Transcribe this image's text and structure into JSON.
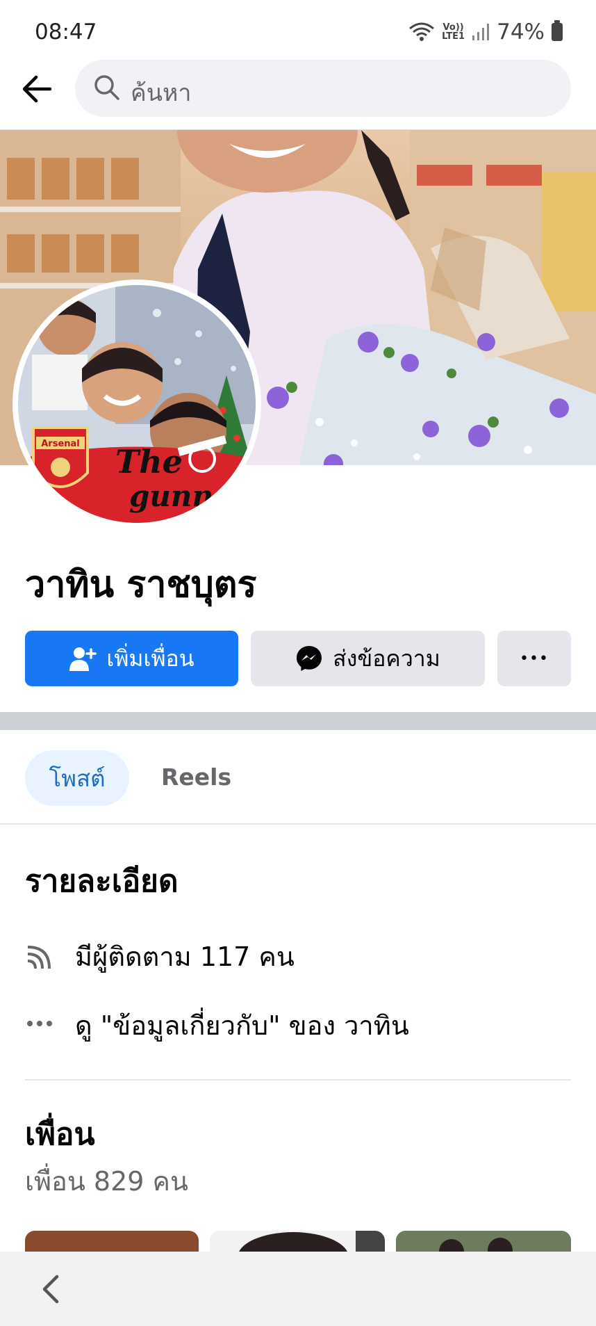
{
  "status_bar": {
    "time": "08:47",
    "network_top": "Vo))",
    "network_bottom": "LTE1",
    "battery": "74%"
  },
  "header": {
    "search_placeholder": "ค้นหา"
  },
  "profile": {
    "name": "วาทิน ราชบุตร",
    "avatar_text_1": "Arsenal",
    "avatar_text_2": "The",
    "avatar_text_3": "gunner"
  },
  "actions": {
    "add_friend": "เพิ่มเพื่อน",
    "message": "ส่งข้อความ",
    "more": "•••"
  },
  "tabs": {
    "posts": "โพสต์",
    "reels": "Reels"
  },
  "details": {
    "title": "รายละเอียด",
    "followers": "มีผู้ติดตาม 117 คน",
    "about": "ดู \"ข้อมูลเกี่ยวกับ\" ของ วาทิน"
  },
  "friends": {
    "title": "เพื่อน",
    "count": "เพื่อน 829 คน"
  },
  "colors": {
    "accent": "#1877f2",
    "tab_active_bg": "#e7f3ff",
    "secondary_button": "#e4e6eb"
  }
}
